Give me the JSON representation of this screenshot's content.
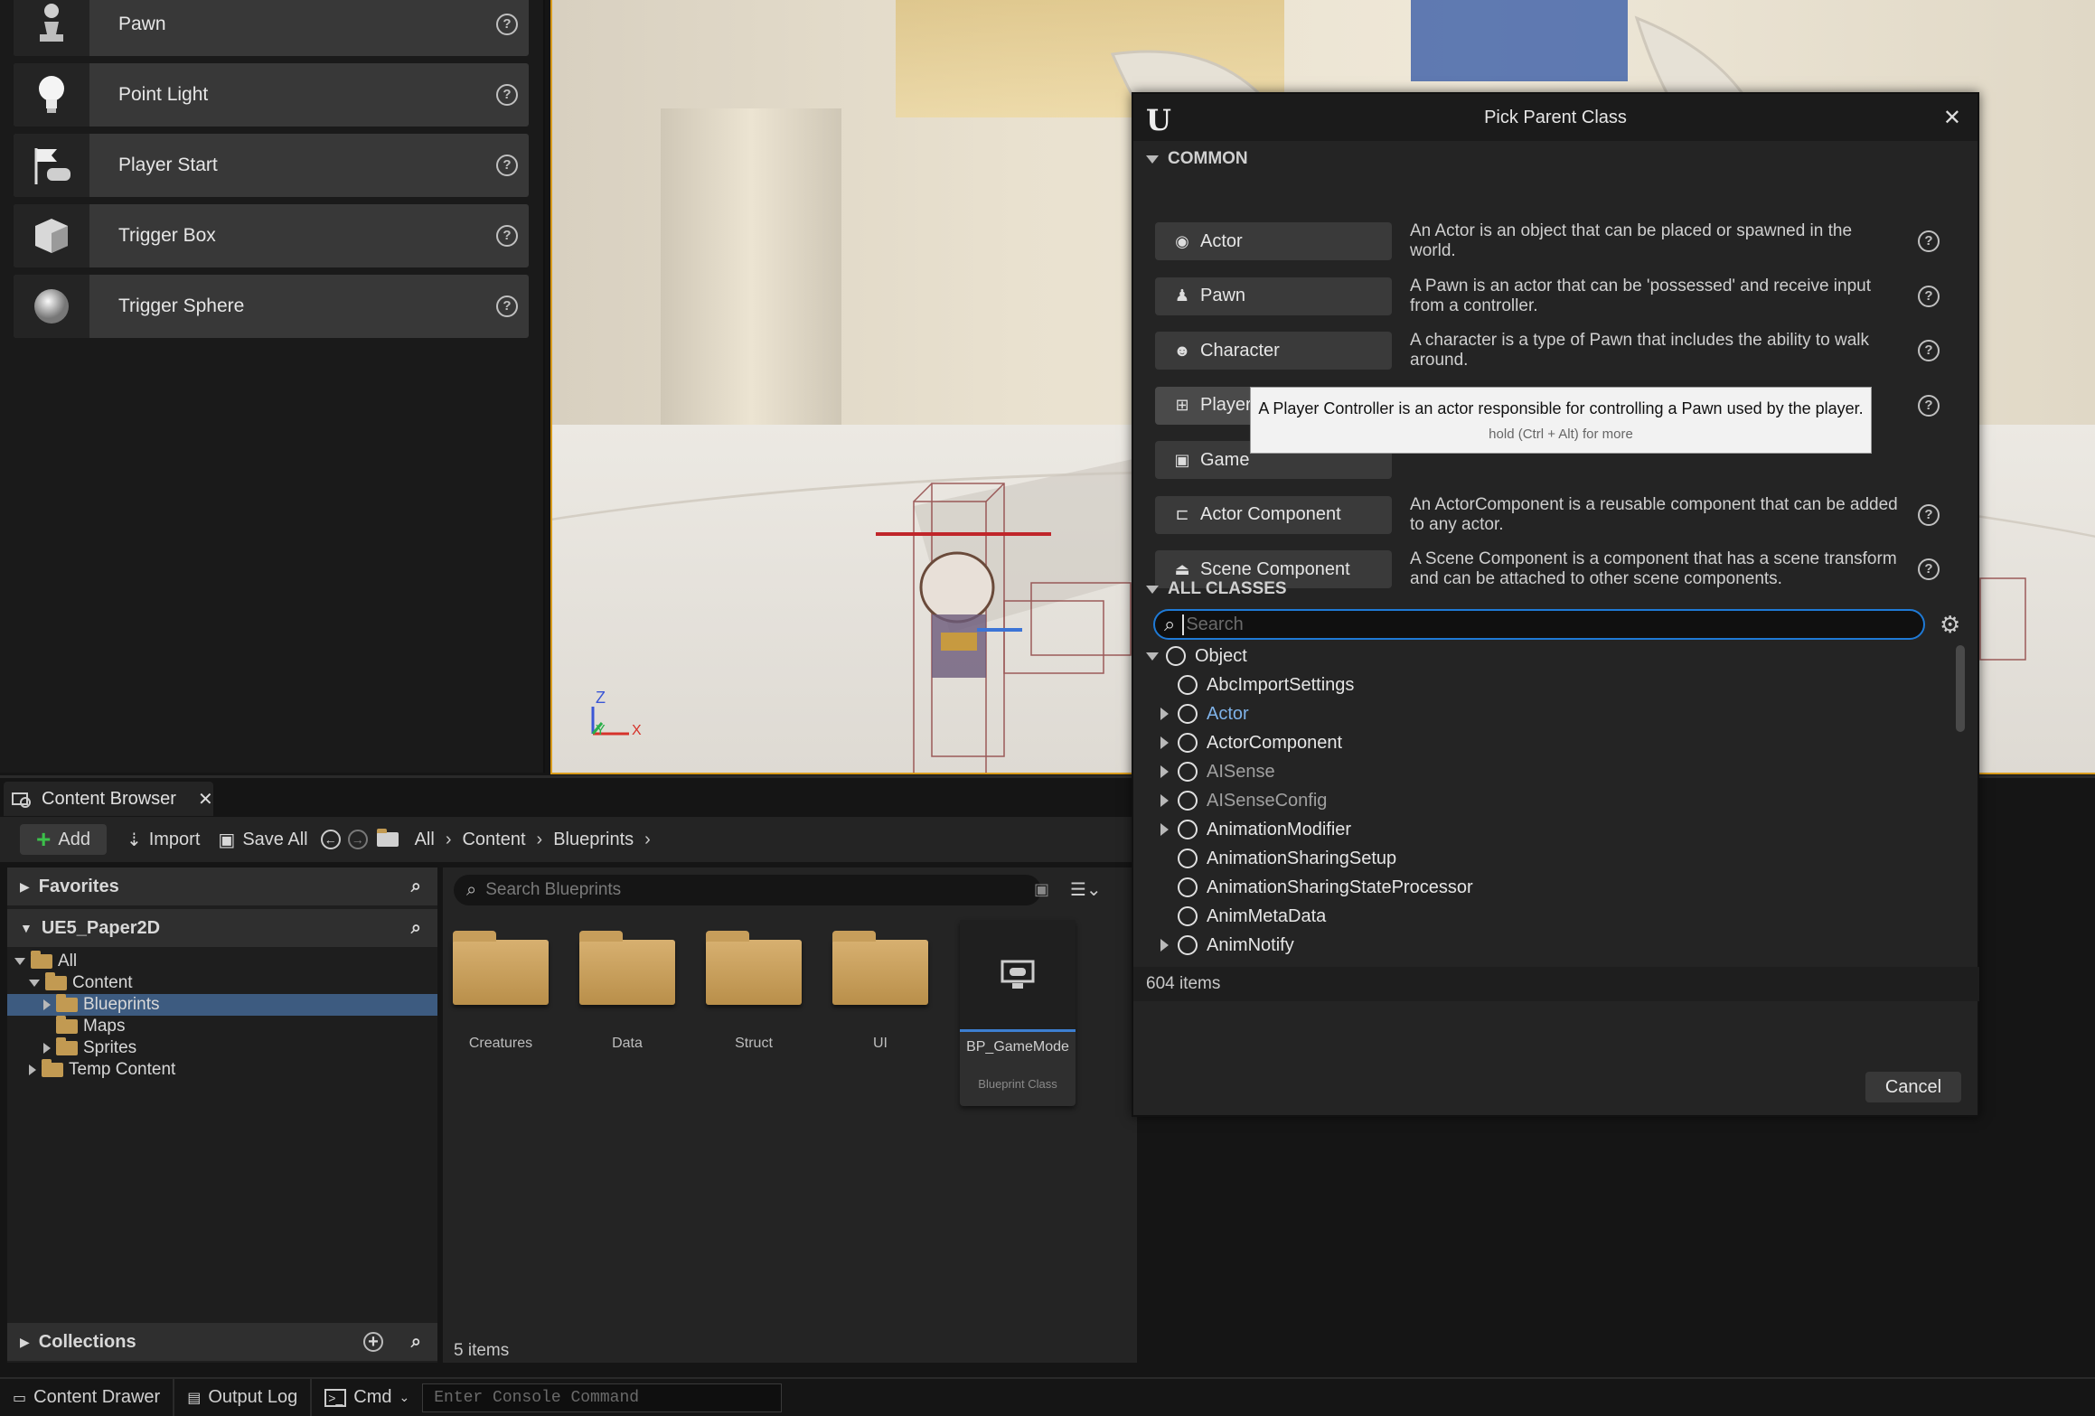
{
  "place_actors": [
    {
      "label": "Pawn",
      "icon": "pawn-icon"
    },
    {
      "label": "Point Light",
      "icon": "light-bulb-icon"
    },
    {
      "label": "Player Start",
      "icon": "player-start-flag-icon"
    },
    {
      "label": "Trigger Box",
      "icon": "trigger-box-icon"
    },
    {
      "label": "Trigger Sphere",
      "icon": "trigger-sphere-icon"
    }
  ],
  "viewport": {
    "axis_labels": [
      "Z",
      "Y",
      "X"
    ]
  },
  "dialog": {
    "title": "Pick Parent Class",
    "common_header": "COMMON",
    "common": [
      {
        "label": "Actor",
        "desc": "An Actor is an object that can be placed or spawned in the world."
      },
      {
        "label": "Pawn",
        "desc": "A Pawn is an actor that can be 'possessed' and receive input from a controller."
      },
      {
        "label": "Character",
        "desc": "A character is a type of Pawn that includes the ability to walk around."
      },
      {
        "label": "Player Controller",
        "desc": "A Player Controller is an actor responsible for controlling a Pawn used by the player."
      },
      {
        "label": "Game",
        "desc": ""
      },
      {
        "label": "Actor Component",
        "desc": "An ActorComponent is a reusable component that can be added to any actor."
      },
      {
        "label": "Scene Component",
        "desc": "A Scene Component is a component that has a scene transform and can be attached to other scene components."
      }
    ],
    "tooltip": {
      "text": "A Player Controller is an actor responsible for controlling a Pawn used by the player.",
      "hint": "hold (Ctrl + Alt) for more"
    },
    "all_header": "ALL CLASSES",
    "search_placeholder": "Search",
    "classes": [
      {
        "label": "Object",
        "expand": "open",
        "indent": 0,
        "tone": "normal"
      },
      {
        "label": "AbcImportSettings",
        "expand": "none",
        "indent": 1,
        "tone": "normal"
      },
      {
        "label": "Actor",
        "expand": "closed",
        "indent": 1,
        "tone": "blue"
      },
      {
        "label": "ActorComponent",
        "expand": "closed",
        "indent": 1,
        "tone": "normal"
      },
      {
        "label": "AISense",
        "expand": "closed",
        "indent": 1,
        "tone": "grey"
      },
      {
        "label": "AISenseConfig",
        "expand": "closed",
        "indent": 1,
        "tone": "grey"
      },
      {
        "label": "AnimationModifier",
        "expand": "closed",
        "indent": 1,
        "tone": "normal"
      },
      {
        "label": "AnimationSharingSetup",
        "expand": "none",
        "indent": 1,
        "tone": "normal"
      },
      {
        "label": "AnimationSharingStateProcessor",
        "expand": "none",
        "indent": 1,
        "tone": "normal"
      },
      {
        "label": "AnimMetaData",
        "expand": "none",
        "indent": 1,
        "tone": "normal"
      },
      {
        "label": "AnimNotify",
        "expand": "closed",
        "indent": 1,
        "tone": "normal"
      }
    ],
    "item_count": "604 items",
    "cancel_label": "Cancel"
  },
  "content_browser": {
    "tab_label": "Content Browser",
    "toolbar": {
      "add": "Add",
      "import": "Import",
      "save_all": "Save All"
    },
    "breadcrumb": [
      "All",
      "Content",
      "Blueprints"
    ],
    "favorites": "Favorites",
    "project": "UE5_Paper2D",
    "tree": [
      {
        "label": "All",
        "indent": 0,
        "expand": "open",
        "selected": false
      },
      {
        "label": "Content",
        "indent": 1,
        "expand": "open",
        "selected": false
      },
      {
        "label": "Blueprints",
        "indent": 2,
        "expand": "closed",
        "selected": true
      },
      {
        "label": "Maps",
        "indent": 2,
        "expand": "none",
        "selected": false
      },
      {
        "label": "Sprites",
        "indent": 2,
        "expand": "closed",
        "selected": false
      },
      {
        "label": "Temp Content",
        "indent": 1,
        "expand": "closed",
        "selected": false
      }
    ],
    "collections": "Collections",
    "search_placeholder": "Search Blueprints",
    "assets": [
      {
        "name": "Creatures"
      },
      {
        "name": "Data"
      },
      {
        "name": "Struct"
      },
      {
        "name": "UI"
      }
    ],
    "blueprint_asset": {
      "name": "BP_GameMode",
      "type": "Blueprint Class"
    },
    "items_count": "5 items"
  },
  "statusbar": {
    "content_drawer": "Content Drawer",
    "output_log": "Output Log",
    "cmd": "Cmd",
    "console_placeholder": "Enter Console Command"
  },
  "colors": {
    "accent_orange": "#d89b1c",
    "selection_blue": "#3d5b80",
    "focus_blue": "#1f7ad6"
  }
}
